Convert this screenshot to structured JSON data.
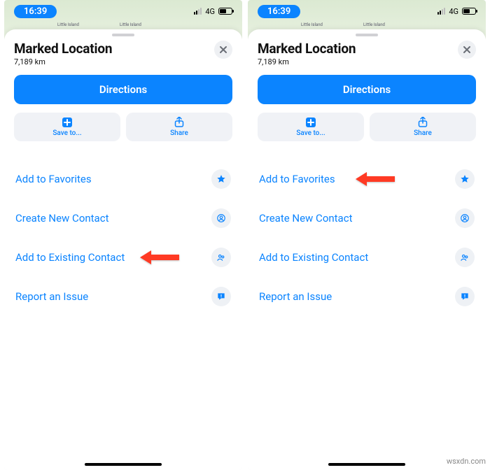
{
  "status": {
    "time": "16:39",
    "network": "4G"
  },
  "sheet": {
    "title": "Marked Location",
    "subtitle": "7,189 km",
    "directions": "Directions",
    "save": "Save to...",
    "share": "Share"
  },
  "rows": {
    "favorites": "Add to Favorites",
    "create": "Create New Contact",
    "existing": "Add to Existing Contact",
    "report": "Report an Issue"
  },
  "map": {
    "label": "Little Island"
  },
  "watermark": "wsxdn.com"
}
